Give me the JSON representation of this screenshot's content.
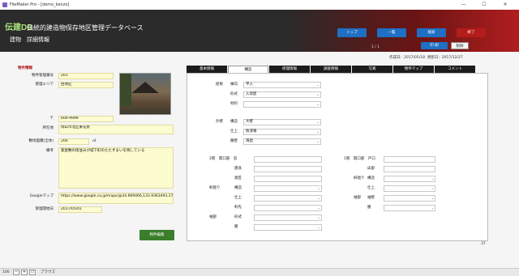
{
  "window": {
    "title": "FileMaker Pro - [demo_kenzo]",
    "minimize": "—",
    "maximize": "☐",
    "close": "✕"
  },
  "header": {
    "logo": "伝建DB",
    "site_name": "伝統的建造物保存地区管理データベース",
    "page_title": "建物　詳細情報",
    "nav": [
      "トップ",
      "一覧",
      "検索",
      "終了"
    ],
    "pager": "1 / 1",
    "print_label": "印 刷",
    "delete_label": "削除",
    "colors": {
      "nav": "#1f6fc4",
      "end": "#b41c1c",
      "logo": "#a8e07a"
    }
  },
  "dates": {
    "created": "作成日：2017/05/18",
    "updated": "更新日：2017/12/27"
  },
  "left": {
    "section_title": "物件情報",
    "fields": [
      {
        "label": "物件管理番号",
        "value": "201"
      },
      {
        "label": "管理エリア",
        "value": "西地区"
      },
      {
        "label": "〒",
        "value": "600-9999"
      },
      {
        "label": "所在地",
        "value": "岡山市北区東花尻"
      },
      {
        "label": "敷地面積(全体)",
        "value": "200",
        "unit": "㎡"
      },
      {
        "label": "備考",
        "value": "家屋敷の街並みが城下町のたたずまいを残している"
      },
      {
        "label": "Googleマップ",
        "value": "https://www.google.co.jp/maps/@34.669466,133.9363493,17z"
      },
      {
        "label": "管理開始日",
        "value": "2017/05/01"
      }
    ],
    "edit_button": "物件編集"
  },
  "tabs": [
    "基本情報",
    "構造",
    "修理情報",
    "調査情報",
    "写真",
    "物件マップ",
    "コメント"
  ],
  "active_tab": 1,
  "structure": {
    "roof_group": "屋根",
    "roof_rows": [
      {
        "label": "棟向",
        "value": "平入"
      },
      {
        "label": "形式",
        "value": "入母屋"
      },
      {
        "label": "材料",
        "value": ""
      }
    ],
    "wall_group": "外壁",
    "wall_rows": [
      {
        "label": "構造",
        "value": "大壁"
      },
      {
        "label": "仕上",
        "value": "防漆喰"
      },
      {
        "label": "腰壁",
        "value": "海鼠"
      }
    ],
    "floor2": {
      "head": "2階　開口部　窓",
      "rows": [
        "建具",
        "意匠"
      ],
      "eaves_label": "軒廻り",
      "eaves_rows": [
        "構造",
        "仕上",
        "軒先"
      ],
      "base_label": "袖部",
      "base_rows": [
        "形式",
        "腰"
      ]
    },
    "floor1": {
      "head": "1階　開口部　戸口",
      "rows": [
        "床部"
      ],
      "eaves_label": "軒廻り",
      "eaves_rows": [
        "構造",
        "仕上"
      ],
      "base_label": "袖部",
      "base_rows": [
        "袖壁",
        "腰"
      ]
    }
  },
  "record_count": "37",
  "statusbar": {
    "zoom": "100",
    "mode": "ブラウズ"
  }
}
